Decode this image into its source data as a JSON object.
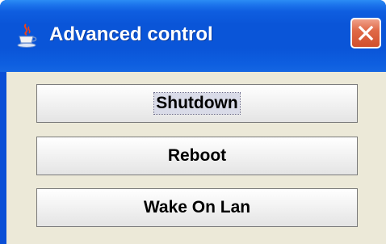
{
  "window": {
    "title": "Advanced control",
    "icon": "java-cup-icon",
    "close_icon": "close-x-icon"
  },
  "buttons": {
    "shutdown_label": "Shutdown",
    "reboot_label": "Reboot",
    "wake_on_lan_label": "Wake On Lan",
    "focused": "Shutdown"
  },
  "colors": {
    "titlebar": "#0a55d8",
    "client_background": "#ece9d8",
    "close_button": "#d14f2c"
  }
}
